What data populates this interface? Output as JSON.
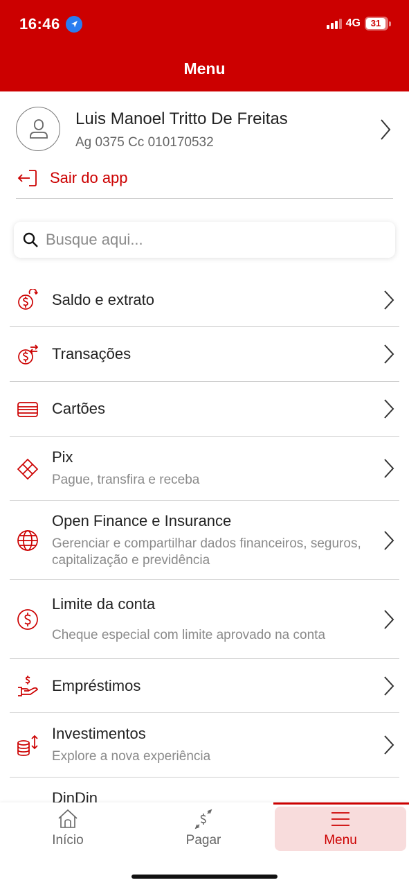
{
  "status_bar": {
    "time": "16:46",
    "network": "4G",
    "battery": "31"
  },
  "header": {
    "title": "Menu"
  },
  "profile": {
    "name": "Luis Manoel Tritto De Freitas",
    "account": "Ag 0375 Cc 010170532"
  },
  "logout": {
    "label": "Sair do app"
  },
  "search": {
    "placeholder": "Busque aqui..."
  },
  "menu": {
    "items": [
      {
        "title": "Saldo e extrato",
        "icon": "money-refresh-icon"
      },
      {
        "title": "Transações",
        "icon": "money-transfer-icon"
      },
      {
        "title": "Cartões",
        "icon": "card-icon"
      },
      {
        "title": "Pix",
        "subtitle": "Pague, transfira e receba",
        "icon": "pix-icon"
      },
      {
        "title": "Open Finance e Insurance",
        "subtitle": "Gerenciar e compartilhar dados financeiros, seguros, capitalização e previdência",
        "icon": "globe-icon"
      },
      {
        "title": "Limite da conta",
        "subtitle": "Cheque especial com limite aprovado na conta",
        "icon": "dollar-circle-icon"
      },
      {
        "title": "Empréstimos",
        "icon": "loan-hand-icon"
      },
      {
        "title": "Investimentos",
        "subtitle": "Explore a nova experiência",
        "icon": "coins-invest-icon"
      },
      {
        "title": "DinDin",
        "icon": "dindin-icon"
      }
    ]
  },
  "tabbar": {
    "tabs": [
      {
        "label": "Início",
        "icon": "home-icon",
        "active": false
      },
      {
        "label": "Pagar",
        "icon": "pay-icon",
        "active": false
      },
      {
        "label": "Menu",
        "icon": "menu-icon",
        "active": true
      }
    ]
  },
  "colors": {
    "brand": "#cc0000",
    "active_tab_bg": "#f8dcdc",
    "subtitle": "#8a8a8a"
  }
}
